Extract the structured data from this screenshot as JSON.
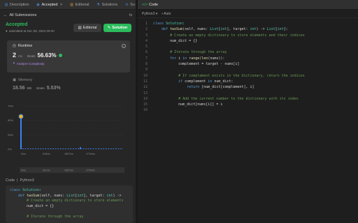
{
  "tabs": [
    {
      "label": "Description",
      "icon": "description-icon"
    },
    {
      "label": "Accepted",
      "icon": "accepted-icon"
    },
    {
      "label": "Editorial",
      "icon": "editorial-icon"
    },
    {
      "label": "Solutions",
      "icon": "solutions-icon"
    },
    {
      "label": "Su",
      "icon": "submissions-icon"
    }
  ],
  "subbar": {
    "back_label": "All Submissions"
  },
  "status": {
    "result": "Accepted",
    "submitted_by": "submitted at Dec 08, 2024 09:20",
    "editorial_label": "Editorial",
    "solution_label": "Solution"
  },
  "runtime": {
    "title": "Runtime",
    "value": "2",
    "unit": "ms",
    "beats_label": "Beats",
    "beats_pct": "56.63%",
    "complexity_label": "Analyze Complexity"
  },
  "memory": {
    "title": "Memory",
    "value": "18.56",
    "unit": "MB",
    "beats_label": "Beats",
    "beats_pct": "5.53%"
  },
  "chart_data": {
    "type": "bar",
    "y_ticks": [
      "75%",
      "50%",
      "25%",
      "0%"
    ],
    "x_ticks": [
      "0ms",
      "616ms",
      "1807ms",
      "2710ms"
    ],
    "brush_ticks": [
      "0ms",
      "911ms",
      "1807ms",
      "2709ms"
    ],
    "highlight_x": 0,
    "highlight_y": 56.63,
    "ylim": [
      0,
      75
    ]
  },
  "left_code": {
    "header_label": "Code",
    "language": "Python3",
    "lines": [
      "class Solution:",
      "    def twoSum(self, nums: List[int], target: int) ->",
      "        # Create an empty dictionary to store elements",
      "        num_dict = {}",
      "",
      "        # Iterate through the array"
    ]
  },
  "right": {
    "title": "Code",
    "language": "Python3",
    "mode": "Auto",
    "line_numbers": [
      "1",
      "2",
      "3",
      "4",
      "5",
      "6",
      "7",
      "8",
      "9",
      "10",
      "11",
      "12",
      "13",
      "14",
      "15",
      "16"
    ],
    "lines": [
      "class Solution:",
      "    def twoSum(self, nums: List[int], target: int) -> List[int]:",
      "        # Create an empty dictionary to store elements and their indices",
      "        num_dict = {}",
      "",
      "        # Iterate through the array",
      "        for i in range(len(nums)):",
      "            complement = target - nums[i]",
      "",
      "            # If complement exists in the dictionary, return the indices",
      "            if complement in num_dict:",
      "                return [num_dict[complement], i]",
      "",
      "            # Add the current number to the dictionary with its index",
      "            num_dict[nums[i]] = i",
      ""
    ]
  },
  "colors": {
    "accent": "#2cbb5d",
    "complexity": "#b18cf2",
    "bar": "#3b82f6"
  }
}
